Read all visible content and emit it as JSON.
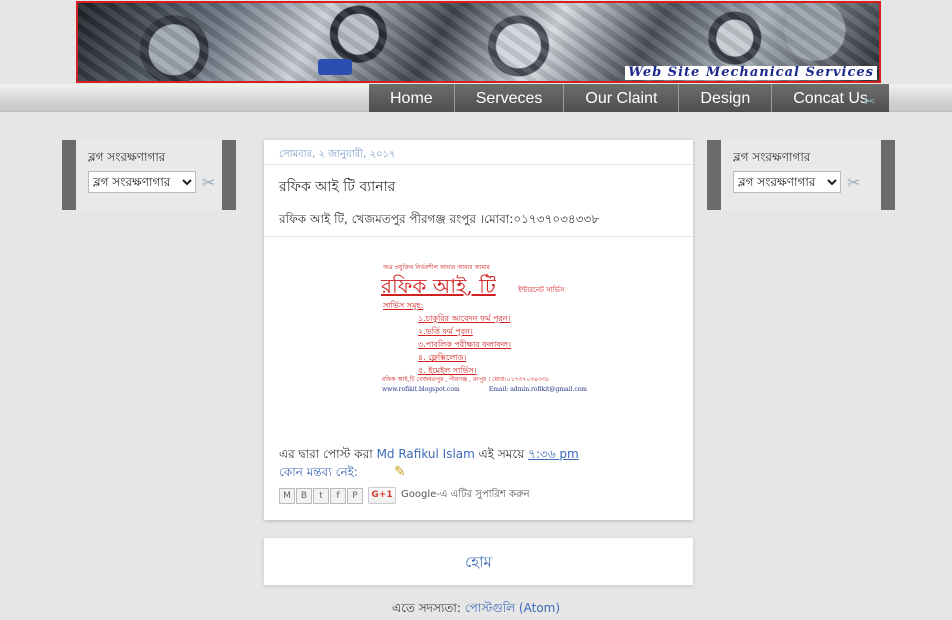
{
  "header": {
    "banner_caption": "Web Site Mechanical Services"
  },
  "nav": {
    "items": [
      "Home",
      "Serveces",
      "Our Claint",
      "Design",
      "Concat Us"
    ]
  },
  "left_widget": {
    "title": "ব্লগ সংরক্ষণাগার",
    "select_value": "ব্লগ সংরক্ষণাগার"
  },
  "right_widget": {
    "title": "ব্লগ সংরক্ষণাগার",
    "select_value": "ব্লগ সংরক্ষণাগার"
  },
  "post": {
    "date": "সোমবার, ২ জানুয়ারী, ২০১৭",
    "title": "রফিক আই টি ব্যানার",
    "body": "রফিক আই টি, খেজমতপুর পীরগঞ্জ রংপুর ।মোবা:০১৭৩৭০৩৪৩৩৮",
    "image": {
      "top_text": "অত্র প্রযুক্তির নির্ভরশীল আমার আমার আমার",
      "name": "রফিক  আই, টি",
      "institute": "ইন্টারনেট সার্ভিস",
      "services_heading": "সার্ভিস সমূহ:",
      "services": [
        "১.চাকুরির আবেদন ফর্ম পূরন।",
        "২.ভর্তি ফর্ম পূরন।",
        "৩.পাবলিক পরীক্ষার ফলাফল।",
        "৪. ফ্লেক্সিলোড।",
        "৫. ইমেইল সার্ভিস।"
      ],
      "footer": "রফিক আই,টি খেজমতপুর , পীরগঞ্জ , রংপুর । মোবা:০১৭৩৭০৩৪৩৩৮",
      "website": "www.rofikit.blogspot.com",
      "email": "Email: admin.rofikit@gmail.com"
    },
    "author_prefix": "এর দ্বারা পোস্ট করা",
    "author": "Md Rafikul Islam",
    "time_prefix": "এই সময়ে",
    "time": "৭:৩৬ pm",
    "comments": "কোন মন্তব্য নেই:",
    "share_buttons": [
      "M",
      "B",
      "t",
      "f",
      "P"
    ],
    "gplus_label": "G+1",
    "gplus_text": "Google-এ এটির সুপারিশ করুন"
  },
  "home_link": "হোম",
  "subscribe": {
    "prefix": "এতে সদস্যতা:",
    "link": "পোস্টগুলি (Atom)"
  }
}
